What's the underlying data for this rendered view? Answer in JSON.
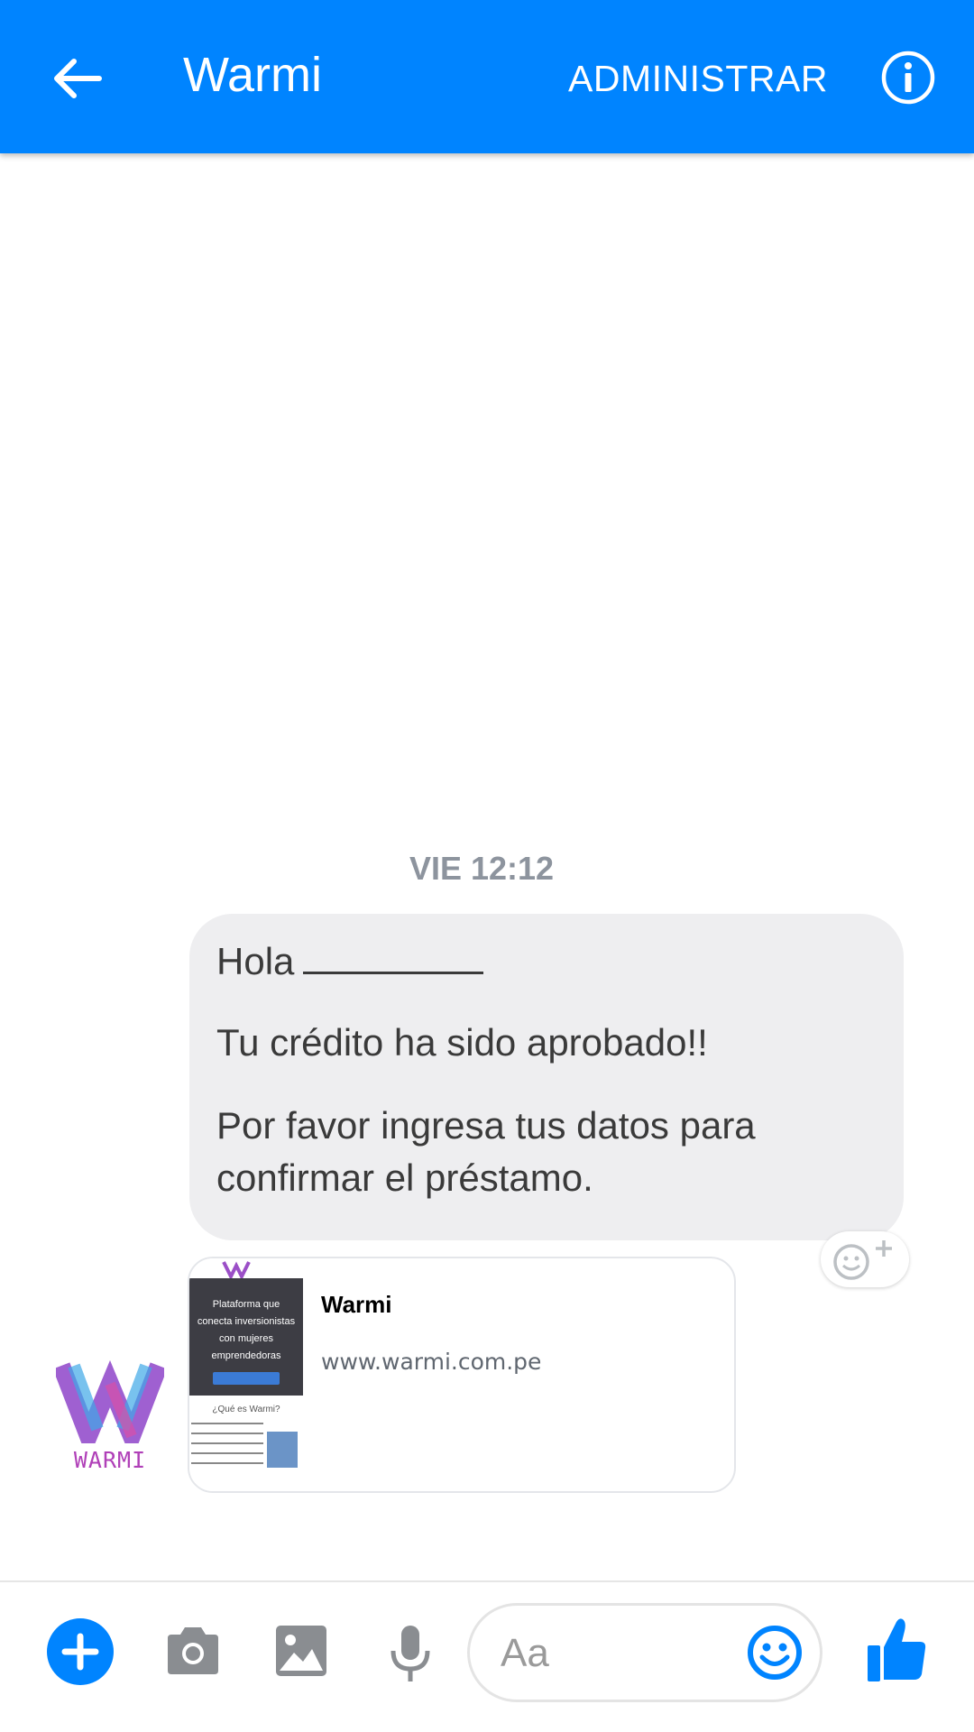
{
  "header": {
    "title": "Warmi",
    "manage_label": "ADMINISTRAR"
  },
  "conversation": {
    "timestamp": "VIE 12:12",
    "message": {
      "greeting": "Hola",
      "line2": "Tu crédito ha sido  aprobado!!",
      "line3": "Por favor ingresa tus datos para confirmar el préstamo."
    },
    "link_card": {
      "title": "Warmi",
      "url": "www.warmi.com.pe",
      "thumbnail": {
        "headline_1": "Plataforma que",
        "headline_2": "conecta inversionistas",
        "headline_3": "con mujeres",
        "headline_4": "emprendedoras",
        "question": "¿Qué es Warmi?"
      }
    },
    "avatar_label": "WARMI"
  },
  "composer": {
    "placeholder": "Aa"
  },
  "colors": {
    "brand_blue": "#0084ff",
    "bubble_gray": "#eeeef0",
    "timestamp_gray": "#8d949e",
    "logo_purple": "#b040b8"
  },
  "icons": [
    "back-arrow-icon",
    "info-icon",
    "add-reaction-icon",
    "plus-icon",
    "camera-icon",
    "image-icon",
    "microphone-icon",
    "emoji-icon",
    "thumbs-up-icon"
  ]
}
